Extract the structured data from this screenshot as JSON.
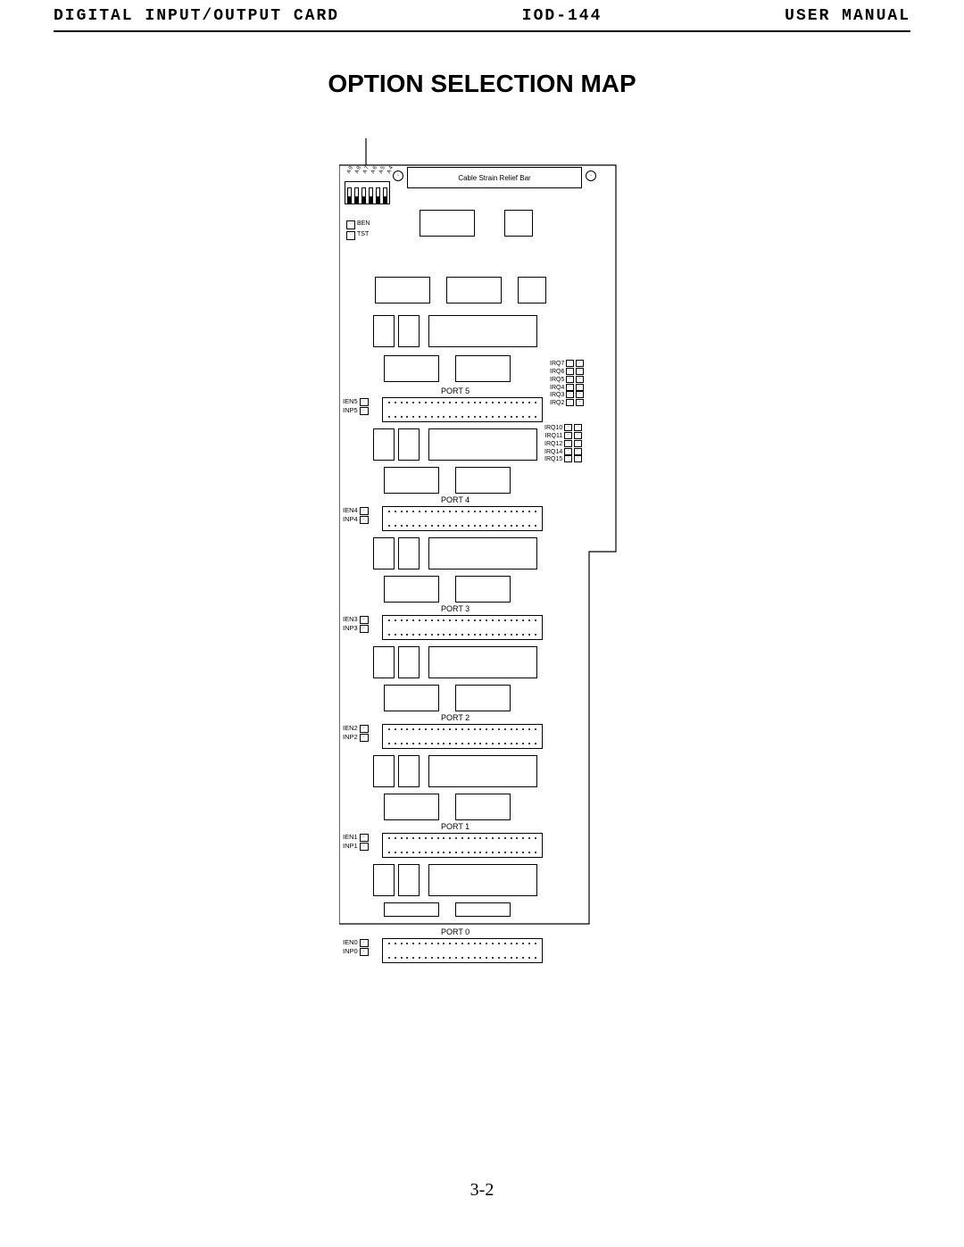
{
  "header": {
    "left": "DIGITAL INPUT/OUTPUT CARD",
    "center": "IOD-144",
    "right": "USER MANUAL"
  },
  "title": "OPTION SELECTION MAP",
  "page_number": "3-2",
  "board": {
    "strain_relief": "Cable Strain Relief Bar",
    "dip_address_bits": [
      "A9",
      "A8",
      "A7",
      "A6",
      "A5",
      "A4"
    ],
    "jumpers_top": [
      "BEN",
      "TST"
    ],
    "ports": [
      {
        "name": "PORT 5",
        "ien": "IEN5",
        "inp": "INP5"
      },
      {
        "name": "PORT 4",
        "ien": "IEN4",
        "inp": "INP4"
      },
      {
        "name": "PORT 3",
        "ien": "IEN3",
        "inp": "INP3"
      },
      {
        "name": "PORT 2",
        "ien": "IEN2",
        "inp": "INP2"
      },
      {
        "name": "PORT 1",
        "ien": "IEN1",
        "inp": "INP1"
      },
      {
        "name": "PORT 0",
        "ien": "IEN0",
        "inp": "INP0"
      }
    ],
    "irq_group_a": [
      "IRQ7",
      "IRQ6",
      "IRQ5",
      "IRQ4",
      "IRQ3",
      "IRQ2"
    ],
    "irq_group_b": [
      "IRQ10",
      "IRQ11",
      "IRQ12",
      "IRQ14",
      "IRQ15"
    ]
  }
}
